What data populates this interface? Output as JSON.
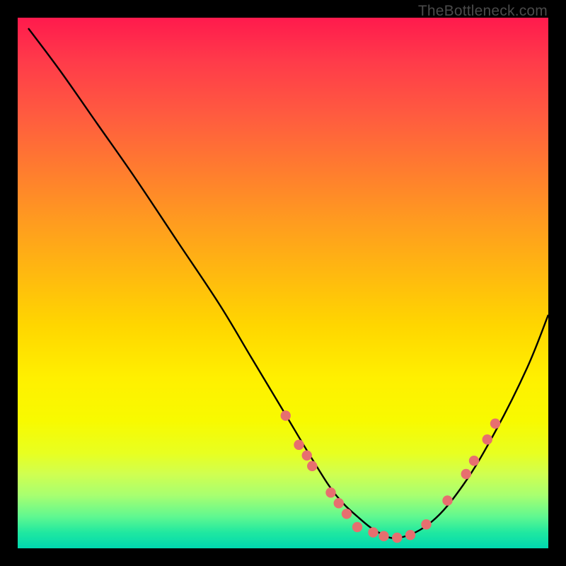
{
  "attribution": "TheBottleneck.com",
  "chart_data": {
    "type": "line",
    "title": "",
    "xlabel": "",
    "ylabel": "",
    "xlim": [
      0,
      100
    ],
    "ylim": [
      0,
      100
    ],
    "grid": false,
    "legend": false,
    "series": [
      {
        "name": "curve",
        "color": "#000000",
        "x": [
          2,
          8,
          15,
          22,
          30,
          38,
          44,
          50,
          56,
          60,
          64,
          68,
          72,
          78,
          84,
          90,
          96,
          100
        ],
        "y": [
          98,
          90,
          80,
          70,
          58,
          46,
          36,
          26,
          16,
          10,
          6,
          3,
          2,
          5,
          12,
          22,
          34,
          44
        ]
      }
    ],
    "markers": [
      {
        "x": 50.5,
        "y": 25.0
      },
      {
        "x": 53.0,
        "y": 19.5
      },
      {
        "x": 54.5,
        "y": 17.5
      },
      {
        "x": 55.5,
        "y": 15.5
      },
      {
        "x": 59.0,
        "y": 10.5
      },
      {
        "x": 60.5,
        "y": 8.5
      },
      {
        "x": 62.0,
        "y": 6.5
      },
      {
        "x": 64.0,
        "y": 4.0
      },
      {
        "x": 67.0,
        "y": 3.0
      },
      {
        "x": 69.0,
        "y": 2.3
      },
      {
        "x": 71.5,
        "y": 2.0
      },
      {
        "x": 74.0,
        "y": 2.5
      },
      {
        "x": 77.0,
        "y": 4.5
      },
      {
        "x": 81.0,
        "y": 9.0
      },
      {
        "x": 84.5,
        "y": 14.0
      },
      {
        "x": 86.0,
        "y": 16.5
      },
      {
        "x": 88.5,
        "y": 20.5
      },
      {
        "x": 90.0,
        "y": 23.5
      }
    ],
    "marker_color": "#e76f6f",
    "background_gradient": {
      "top": "#ff1a4d",
      "mid": "#ffd600",
      "bottom": "#00d8b0"
    }
  }
}
